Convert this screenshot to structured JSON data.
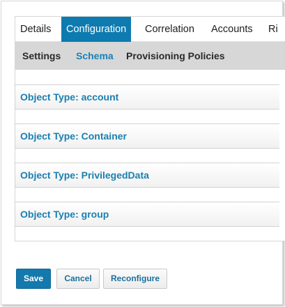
{
  "tabs": [
    {
      "label": "Details",
      "active": false
    },
    {
      "label": "Configuration",
      "active": true
    },
    {
      "label": "Correlation",
      "active": false
    },
    {
      "label": "Accounts",
      "active": false
    },
    {
      "label": "Ri",
      "active": false
    }
  ],
  "subtabs": [
    {
      "label": "Settings",
      "active": false
    },
    {
      "label": "Schema",
      "active": true
    },
    {
      "label": "Provisioning Policies",
      "active": false
    }
  ],
  "object_types": [
    {
      "label": "Object Type: account"
    },
    {
      "label": "Object Type: Container"
    },
    {
      "label": "Object Type: PrivilegedData"
    },
    {
      "label": "Object Type: group"
    }
  ],
  "buttons": {
    "save": "Save",
    "cancel": "Cancel",
    "reconfigure": "Reconfigure"
  },
  "colors": {
    "accent": "#0e7bb0",
    "link_text": "#1a7fb0",
    "subtab_bar": "#d7d7d7"
  }
}
